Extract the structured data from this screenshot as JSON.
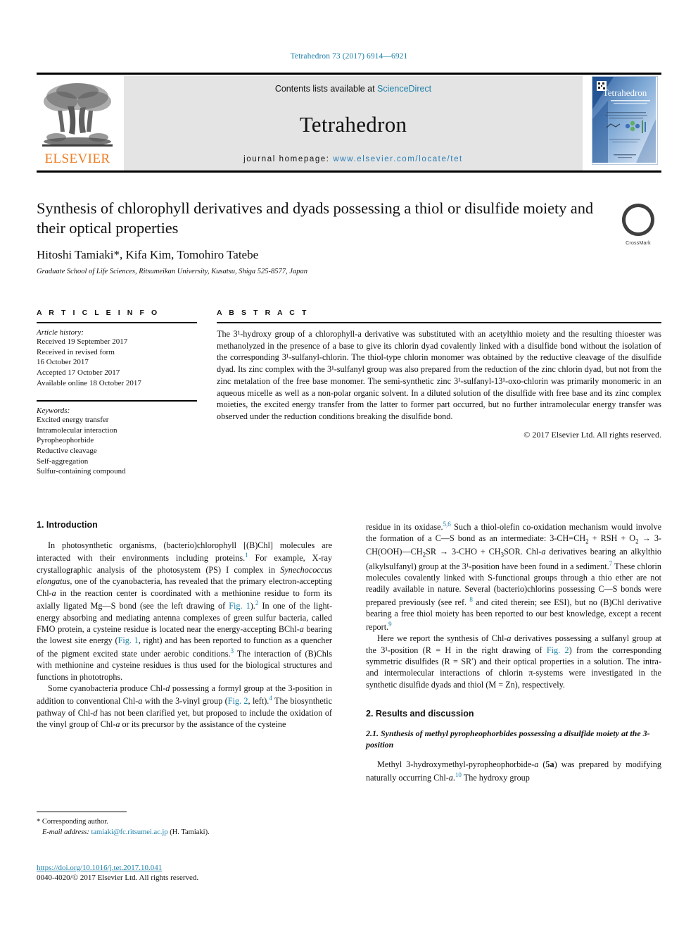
{
  "running_head": "Tetrahedron 73 (2017) 6914—6921",
  "masthead": {
    "contents_prefix": "Contents lists available at ",
    "contents_link": "ScienceDirect",
    "journal_title": "Tetrahedron",
    "homepage_prefix": "journal homepage: ",
    "homepage_url": "www.elsevier.com/locate/tet",
    "publisher_wordmark": "ELSEVIER",
    "cover_title": "Tetrahedron"
  },
  "article": {
    "title": "Synthesis of chlorophyll derivatives and dyads possessing a thiol or disulfide moiety and their optical properties",
    "authors": "Hitoshi Tamiaki*, Kifa Kim, Tomohiro Tatebe",
    "affiliation": "Graduate School of Life Sciences, Ritsumeikan University, Kusatsu, Shiga 525-8577, Japan",
    "crossmark_label": "CrossMark"
  },
  "info": {
    "heading": "A R T I C L E   I N F O",
    "history_label": "Article history:",
    "history": [
      "Received 19 September 2017",
      "Received in revised form",
      "16 October 2017",
      "Accepted 17 October 2017",
      "Available online 18 October 2017"
    ],
    "keywords_label": "Keywords:",
    "keywords": [
      "Excited energy transfer",
      "Intramolecular interaction",
      "Pyropheophorbide",
      "Reductive cleavage",
      "Self-aggregation",
      "Sulfur-containing compound"
    ]
  },
  "abstract": {
    "heading": "A B S T R A C T",
    "text": "The 3¹-hydroxy group of a chlorophyll-a derivative was substituted with an acetylthio moiety and the resulting thioester was methanolyzed in the presence of a base to give its chlorin dyad covalently linked with a disulfide bond without the isolation of the corresponding 3¹-sulfanyl-chlorin. The thiol-type chlorin monomer was obtained by the reductive cleavage of the disulfide dyad. Its zinc complex with the 3¹-sulfanyl group was also prepared from the reduction of the zinc chlorin dyad, but not from the zinc metalation of the free base monomer. The semi-synthetic zinc 3¹-sulfanyl-13¹-oxo-chlorin was primarily monomeric in an aqueous micelle as well as a non-polar organic solvent. In a diluted solution of the disulfide with free base and its zinc complex moieties, the excited energy transfer from the latter to former part occurred, but no further intramolecular energy transfer was observed under the reduction conditions breaking the disulfide bond.",
    "copyright": "© 2017 Elsevier Ltd. All rights reserved."
  },
  "body": {
    "section1_heading": "1. Introduction",
    "left_p1_a": "In photosynthetic organisms, (bacterio)chlorophyll [(B)Chl] molecules are interacted with their environments including proteins.",
    "left_p1_cite1": "1",
    "left_p1_b": " For example, X-ray crystallographic analysis of the photosystem (PS) I complex in ",
    "left_p1_italic1": "Synechococcus elongatus",
    "left_p1_c": ", one of the cyanobacteria, has revealed that the primary electron-accepting Chl-",
    "left_p1_italic2": "a",
    "left_p1_d": " in the reaction center is coordinated with a methionine residue to form its axially ligated Mg—S bond (see the left drawing of ",
    "left_p1_fig1": "Fig. 1",
    "left_p1_e": ").",
    "left_p1_cite2": "2",
    "left_p1_f": " In one of the light-energy absorbing and mediating antenna complexes of green sulfur bacteria, called FMO protein, a cysteine residue is located near the energy-accepting BChl-",
    "left_p1_italic3": "a",
    "left_p1_g": " bearing the lowest site energy (",
    "left_p1_fig2": "Fig. 1",
    "left_p1_h": ", right) and has been reported to function as a quencher of the pigment excited state under aerobic conditions.",
    "left_p1_cite3": "3",
    "left_p1_i": " The interaction of (B)Chls with methionine and cysteine residues is thus used for the biological structures and functions in phototrophs.",
    "left_p2_a": "Some cyanobacteria produce Chl-",
    "left_p2_italic1": "d",
    "left_p2_b": " possessing a formyl group at the 3-position in addition to conventional Chl-",
    "left_p2_italic2": "a",
    "left_p2_c": " with the 3-vinyl group (",
    "left_p2_fig": "Fig. 2",
    "left_p2_d": ", left).",
    "left_p2_cite": "4",
    "left_p2_e": " The biosynthetic pathway of Chl-",
    "left_p2_italic3": "d",
    "left_p2_f": " has not been clarified yet, but proposed to include the oxidation of the vinyl group of Chl-",
    "left_p2_italic4": "a",
    "left_p2_g": " or its precursor by the assistance of the cysteine",
    "right_p1_a": "residue in its oxidase.",
    "right_p1_cite1": "5,6",
    "right_p1_b": " Such a thiol-olefin co-oxidation mechanism would involve the formation of a C—S bond as an intermediate: 3-CH=CH",
    "right_p1_sub1": "2",
    "right_p1_c": " + RSH + O",
    "right_p1_sub2": "2",
    "right_p1_d": " → 3-CH(OOH)—CH",
    "right_p1_sub3": "2",
    "right_p1_e": "SR → 3-CHO + CH",
    "right_p1_sub4": "3",
    "right_p1_f": "SOR. Chl-",
    "right_p1_italic1": "a",
    "right_p1_g": " derivatives bearing an alkylthio (alkylsulfanyl) group at the 3¹-position have been found in a sediment.",
    "right_p1_cite2": "7",
    "right_p1_h": " These chlorin molecules covalently linked with S-functional groups through a thio ether are not readily available in nature. Several (bacterio)chlorins possessing C—S bonds were prepared previously (see ref. ",
    "right_p1_cite3": "8",
    "right_p1_i": " and cited therein; see ESI), but no (B)Chl derivative bearing a free thiol moiety has been reported to our best knowledge, except a recent report.",
    "right_p1_cite4": "9",
    "right_p2_a": "Here we report the synthesis of Chl-",
    "right_p2_italic1": "a",
    "right_p2_b": " derivatives possessing a sulfanyl group at the 3¹-position (R = H in the right drawing of ",
    "right_p2_fig": "Fig. 2",
    "right_p2_c": ") from the corresponding symmetric disulfides (R = SR′) and their optical properties in a solution. The intra- and intermolecular interactions of chlorin π-systems were investigated in the synthetic disulfide dyads and thiol (M = Zn), respectively.",
    "section2_heading": "2. Results and discussion",
    "subsection21_heading": "2.1. Synthesis of methyl pyropheophorbides possessing a disulfide moiety at the 3-position",
    "right_p3_a": "Methyl 3-hydroxymethyl-pyropheophorbide-",
    "right_p3_italic1": "a",
    "right_p3_b": " (",
    "right_p3_bold1": "5a",
    "right_p3_c": ") was prepared by modifying naturally occurring Chl-",
    "right_p3_italic2": "a",
    "right_p3_d": ".",
    "right_p3_cite": "10",
    "right_p3_e": " The hydroxy group"
  },
  "footnote": {
    "corresponding": "* Corresponding author.",
    "email_label": "E-mail address:",
    "email": "tamiaki@fc.ritsumei.ac.jp",
    "email_suffix": " (H. Tamiaki)."
  },
  "footer": {
    "doi": "https://doi.org/10.1016/j.tet.2017.10.041",
    "issn_line": "0040-4020/© 2017 Elsevier Ltd. All rights reserved."
  },
  "colors": {
    "link_blue": "#1b7fa8",
    "elsevier_orange": "#ef7d22",
    "band_gray": "#e4e4e4"
  }
}
